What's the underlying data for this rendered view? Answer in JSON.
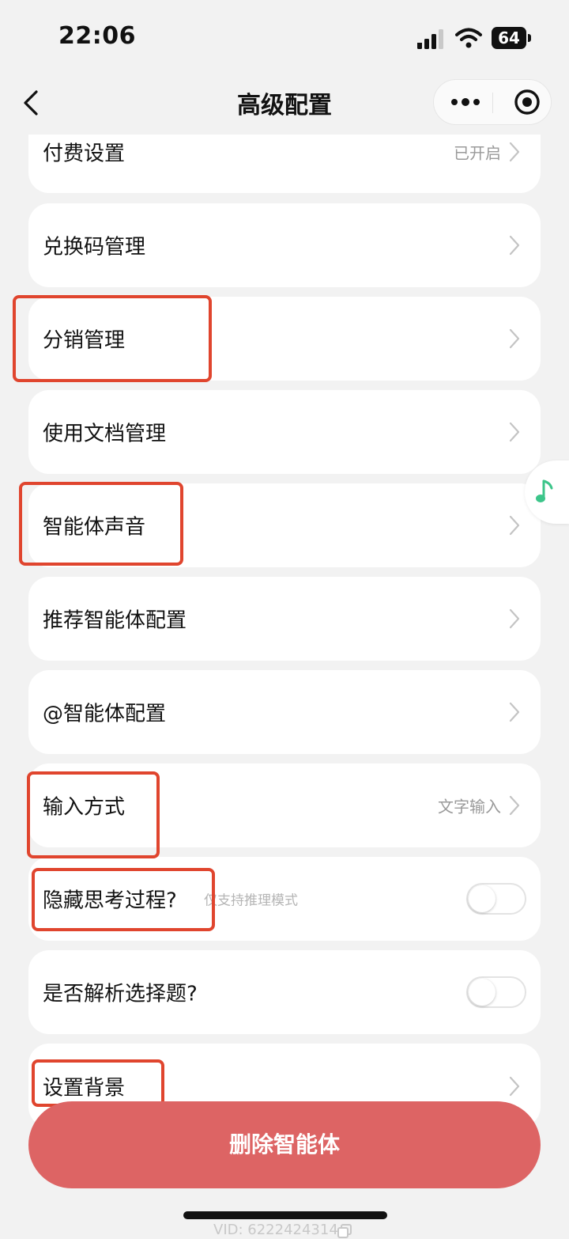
{
  "status_bar": {
    "time": "22:06",
    "battery": "64"
  },
  "nav": {
    "title": "高级配置"
  },
  "items": [
    {
      "label": "付费设置",
      "value": "已开启"
    },
    {
      "label": "兑换码管理"
    },
    {
      "label": "分销管理"
    },
    {
      "label": "使用文档管理"
    },
    {
      "label": "智能体声音"
    },
    {
      "label": "推荐智能体配置"
    },
    {
      "label": "@智能体配置"
    },
    {
      "label": "输入方式",
      "value": "文字输入"
    },
    {
      "label": "隐藏思考过程?",
      "hint": "仅支持推理模式",
      "toggle_on": false
    },
    {
      "label": "是否解析选择题?",
      "toggle_on": false
    },
    {
      "label": "设置背景"
    }
  ],
  "delete_button": {
    "label": "删除智能体"
  },
  "footer": {
    "vid": "VID: 6222424314"
  },
  "colors": {
    "page_bg": "#f2f2f2",
    "card_bg": "#ffffff",
    "delete_button": "#dd6464",
    "annotation_red": "#e0452e",
    "music_accent": "#3cc58a"
  },
  "icons": [
    "back-icon",
    "more-icon",
    "target-icon",
    "chevron-right-icon",
    "music-note-icon",
    "copy-icon"
  ]
}
